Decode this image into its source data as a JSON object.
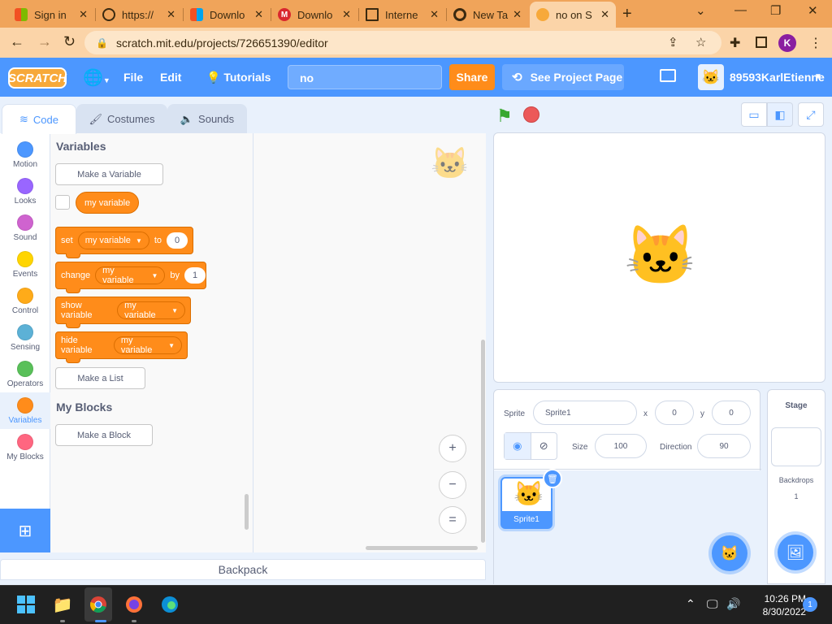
{
  "browser": {
    "tabs": [
      {
        "label": "Sign in",
        "icon": "microsoft-icon",
        "color": "#f25022"
      },
      {
        "label": "https://",
        "icon": "globe-icon",
        "color": "#3b2a10"
      },
      {
        "label": "Downlo",
        "icon": "microsoft-icon",
        "color": "#f25022"
      },
      {
        "label": "Downlo",
        "icon": "mega-icon",
        "color": "#d9272e"
      },
      {
        "label": "Interne",
        "icon": "archive-icon",
        "color": "#3b2a10"
      },
      {
        "label": "New Ta",
        "icon": "chrome-icon",
        "color": "#3b2a10"
      },
      {
        "label": "no on S",
        "icon": "scratch-icon",
        "color": "#f7a93a"
      }
    ],
    "url": "scratch.mit.edu/projects/726651390/editor",
    "profile_initial": "K",
    "accent": "#f0a45a"
  },
  "menubar": {
    "logo": "SCRATCH",
    "file": "File",
    "edit": "Edit",
    "tutorials": "Tutorials",
    "project_title": "no",
    "share": "Share",
    "see_project": "See Project Page",
    "username": "89593KarlEtienne",
    "color": "#4c97ff"
  },
  "editor_tabs": {
    "code": "Code",
    "costumes": "Costumes",
    "sounds": "Sounds"
  },
  "categories": [
    {
      "label": "Motion",
      "color": "#4c97ff"
    },
    {
      "label": "Looks",
      "color": "#9966ff"
    },
    {
      "label": "Sound",
      "color": "#cf63cf"
    },
    {
      "label": "Events",
      "color": "#ffd500"
    },
    {
      "label": "Control",
      "color": "#ffab19"
    },
    {
      "label": "Sensing",
      "color": "#5cb1d6"
    },
    {
      "label": "Operators",
      "color": "#59c059"
    },
    {
      "label": "Variables",
      "color": "#ff8c1a"
    },
    {
      "label": "My Blocks",
      "color": "#ff6680"
    }
  ],
  "palette": {
    "variables_heading": "Variables",
    "make_variable": "Make a Variable",
    "variable_name": "my variable",
    "set_block": {
      "verb": "set",
      "var": "my variable",
      "joiner": "to",
      "value": "0"
    },
    "change_block": {
      "verb": "change",
      "var": "my variable",
      "joiner": "by",
      "value": "1"
    },
    "show_block": {
      "verb": "show variable",
      "var": "my variable"
    },
    "hide_block": {
      "verb": "hide variable",
      "var": "my variable"
    },
    "make_list": "Make a List",
    "myblocks_heading": "My Blocks",
    "make_block": "Make a Block"
  },
  "script_area": {
    "zoom_in": "+",
    "zoom_out": "−",
    "zoom_reset": "="
  },
  "backpack": "Backpack",
  "sprite_info": {
    "sprite_label": "Sprite",
    "sprite_name": "Sprite1",
    "x_label": "x",
    "x_value": "0",
    "y_label": "y",
    "y_value": "0",
    "size_label": "Size",
    "size_value": "100",
    "direction_label": "Direction",
    "direction_value": "90"
  },
  "sprites": [
    {
      "name": "Sprite1"
    }
  ],
  "stage_pane": {
    "heading": "Stage",
    "backdrops_label": "Backdrops",
    "backdrops_count": "1"
  },
  "taskbar": {
    "time": "10:26 PM",
    "date": "8/30/2022",
    "notifications": "1"
  }
}
